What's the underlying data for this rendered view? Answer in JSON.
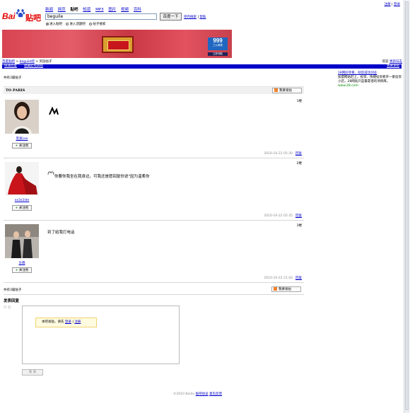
{
  "toplinks": {
    "register": "注册",
    "login": "登录",
    "sep": "|"
  },
  "logo": {
    "bai": "Bai",
    "tieba": "贴吧"
  },
  "nav": [
    "新闻",
    "网页",
    "贴吧",
    "知道",
    "MP3",
    "图片",
    "视频",
    "百科"
  ],
  "nav_current": "贴吧",
  "search": {
    "value": "beguile",
    "button": "百度一下",
    "link1": "吧内搜索",
    "link2": "帮助",
    "sep": "|"
  },
  "radios": [
    {
      "label": "进入贴吧",
      "selected": true
    },
    {
      "label": "进入话题吧",
      "selected": false
    },
    {
      "label": "帖子搜索",
      "selected": false
    }
  ],
  "banner": {
    "badge": "999",
    "sub": "三九胃泰",
    "caption": "立即领取"
  },
  "breadcrumb": {
    "home": "百度贴吧",
    "sep": ">",
    "forum": "beguile吧",
    "current": "浏览帖子"
  },
  "breadcrumb_right": {
    "prefix": "欢迎",
    "link": "更新日志"
  },
  "bluebar": {
    "left1": "快速回复",
    "left2": "收藏此经典帖",
    "right": "我要发帖"
  },
  "post_count": "共有3篇贴子",
  "thread_title": "TO PARIS",
  "reply_button": "我要发帖",
  "posts": [
    {
      "user": "黑发Lax",
      "follow": "关注他",
      "floor": "1楼",
      "text": "",
      "time": "2010-10-22 05:30",
      "reply": "回复"
    },
    {
      "user": "xx3x1lde",
      "follow": "关注他",
      "floor": "2楼",
      "text": "你要你我坐在我身边，可我还是愿回复你说\"因为温柔你",
      "time": "2010-10-22 05:35",
      "reply": "回复"
    },
    {
      "user": "东偶",
      "follow": "关注他",
      "floor": "3楼",
      "text": "到了给我打电话",
      "time": "2010-10-22 21:42",
      "reply": "回复"
    }
  ],
  "bottom_count": "共有3篇贴子",
  "reply_section": {
    "title": "发表回复",
    "label": "内 容",
    "login_prompt": "本吧发贴，请先",
    "login": "登录",
    "sep": "|",
    "register": "注册",
    "submit": "发 表"
  },
  "footer": {
    "copy": "©2010 Baidu",
    "link1": "贴吧协议",
    "link2": "意见反馈"
  },
  "ad": {
    "title": "28网好项目，助您成功创业",
    "body": "加盟网站赶上，投资、快捷投资者开一家投资小店，28网就只是最靠谱的项目库。",
    "url": "www.28.com"
  },
  "colors": {
    "bluebar": "#0000c8",
    "logo_red": "#e10602",
    "link": "#0000cc"
  }
}
